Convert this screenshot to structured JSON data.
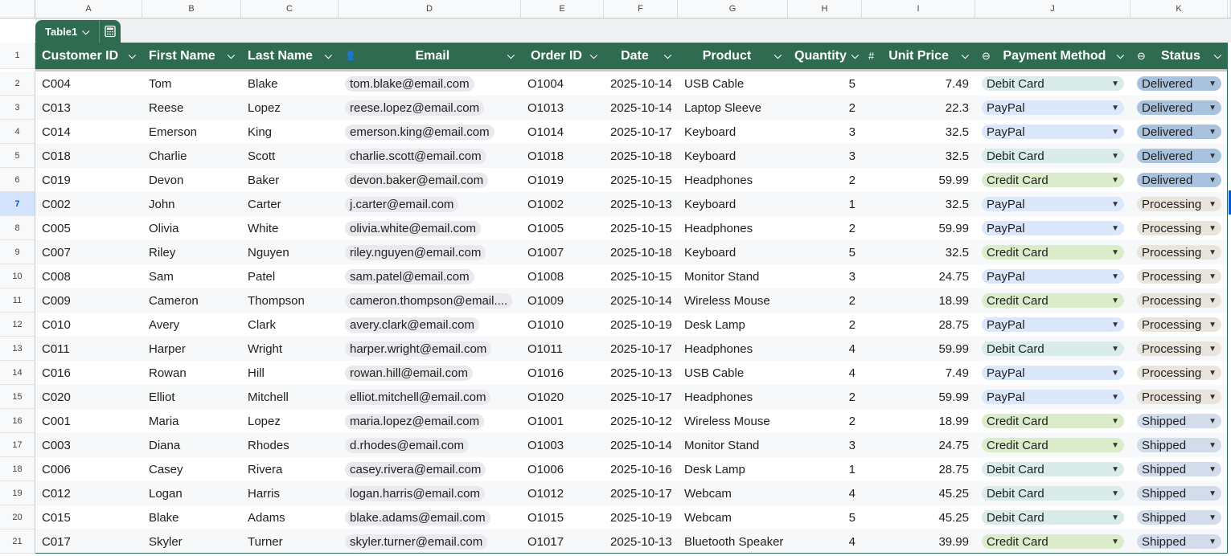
{
  "table": {
    "name": "Table1"
  },
  "colors": {
    "header_bg": "#2f6b50",
    "debit_card": "#d9ecea",
    "paypal": "#dbe8fb",
    "credit_card": "#dbeccb",
    "delivered": "#a9c2de",
    "processing": "#e9e5dd",
    "shipped": "#d3dceb"
  },
  "icons": {
    "email_col": "person-icon",
    "unit_price_col": "hash-icon",
    "dropdown_col": "dropdown-chip-icon",
    "tab_calc": "calculator-icon"
  },
  "column_letters": [
    "A",
    "B",
    "C",
    "D",
    "E",
    "F",
    "G",
    "H",
    "I",
    "J",
    "K"
  ],
  "headers": [
    "Customer ID",
    "First Name",
    "Last Name",
    "Email",
    "Order ID",
    "Date",
    "Product",
    "Quantity",
    "Unit Price",
    "Payment Method",
    "Status"
  ],
  "rows": [
    {
      "n": "2",
      "id": "C004",
      "first": "Tom",
      "last": "Blake",
      "email": "tom.blake@email.com",
      "order": "O1004",
      "date": "2025-10-14",
      "product": "USB Cable",
      "qty": "5",
      "price": "7.49",
      "payment": "Debit Card",
      "status": "Delivered"
    },
    {
      "n": "3",
      "id": "C013",
      "first": "Reese",
      "last": "Lopez",
      "email": "reese.lopez@email.com",
      "order": "O1013",
      "date": "2025-10-14",
      "product": "Laptop Sleeve",
      "qty": "2",
      "price": "22.3",
      "payment": "PayPal",
      "status": "Delivered"
    },
    {
      "n": "4",
      "id": "C014",
      "first": "Emerson",
      "last": "King",
      "email": "emerson.king@email.com",
      "order": "O1014",
      "date": "2025-10-17",
      "product": "Keyboard",
      "qty": "3",
      "price": "32.5",
      "payment": "PayPal",
      "status": "Delivered"
    },
    {
      "n": "5",
      "id": "C018",
      "first": "Charlie",
      "last": "Scott",
      "email": "charlie.scott@email.com",
      "order": "O1018",
      "date": "2025-10-18",
      "product": "Keyboard",
      "qty": "3",
      "price": "32.5",
      "payment": "Debit Card",
      "status": "Delivered"
    },
    {
      "n": "6",
      "id": "C019",
      "first": "Devon",
      "last": "Baker",
      "email": "devon.baker@email.com",
      "order": "O1019",
      "date": "2025-10-15",
      "product": "Headphones",
      "qty": "2",
      "price": "59.99",
      "payment": "Credit Card",
      "status": "Delivered"
    },
    {
      "n": "7",
      "id": "C002",
      "first": "John",
      "last": "Carter",
      "email": "j.carter@email.com",
      "order": "O1002",
      "date": "2025-10-13",
      "product": "Keyboard",
      "qty": "1",
      "price": "32.5",
      "payment": "PayPal",
      "status": "Processing"
    },
    {
      "n": "8",
      "id": "C005",
      "first": "Olivia",
      "last": "White",
      "email": "olivia.white@email.com",
      "order": "O1005",
      "date": "2025-10-15",
      "product": "Headphones",
      "qty": "2",
      "price": "59.99",
      "payment": "PayPal",
      "status": "Processing"
    },
    {
      "n": "9",
      "id": "C007",
      "first": "Riley",
      "last": "Nguyen",
      "email": "riley.nguyen@email.com",
      "order": "O1007",
      "date": "2025-10-18",
      "product": "Keyboard",
      "qty": "5",
      "price": "32.5",
      "payment": "Credit Card",
      "status": "Processing"
    },
    {
      "n": "10",
      "id": "C008",
      "first": "Sam",
      "last": "Patel",
      "email": "sam.patel@email.com",
      "order": "O1008",
      "date": "2025-10-15",
      "product": "Monitor Stand",
      "qty": "3",
      "price": "24.75",
      "payment": "PayPal",
      "status": "Processing"
    },
    {
      "n": "11",
      "id": "C009",
      "first": "Cameron",
      "last": "Thompson",
      "email": "cameron.thompson@email....",
      "order": "O1009",
      "date": "2025-10-14",
      "product": "Wireless Mouse",
      "qty": "2",
      "price": "18.99",
      "payment": "Credit Card",
      "status": "Processing"
    },
    {
      "n": "12",
      "id": "C010",
      "first": "Avery",
      "last": "Clark",
      "email": "avery.clark@email.com",
      "order": "O1010",
      "date": "2025-10-19",
      "product": "Desk Lamp",
      "qty": "2",
      "price": "28.75",
      "payment": "PayPal",
      "status": "Processing"
    },
    {
      "n": "13",
      "id": "C011",
      "first": "Harper",
      "last": "Wright",
      "email": "harper.wright@email.com",
      "order": "O1011",
      "date": "2025-10-17",
      "product": "Headphones",
      "qty": "4",
      "price": "59.99",
      "payment": "Debit Card",
      "status": "Processing"
    },
    {
      "n": "14",
      "id": "C016",
      "first": "Rowan",
      "last": "Hill",
      "email": "rowan.hill@email.com",
      "order": "O1016",
      "date": "2025-10-13",
      "product": "USB Cable",
      "qty": "4",
      "price": "7.49",
      "payment": "PayPal",
      "status": "Processing"
    },
    {
      "n": "15",
      "id": "C020",
      "first": "Elliot",
      "last": "Mitchell",
      "email": "elliot.mitchell@email.com",
      "order": "O1020",
      "date": "2025-10-17",
      "product": "Headphones",
      "qty": "2",
      "price": "59.99",
      "payment": "PayPal",
      "status": "Processing"
    },
    {
      "n": "16",
      "id": "C001",
      "first": "Maria",
      "last": "Lopez",
      "email": "maria.lopez@email.com",
      "order": "O1001",
      "date": "2025-10-12",
      "product": "Wireless Mouse",
      "qty": "2",
      "price": "18.99",
      "payment": "Credit Card",
      "status": "Shipped"
    },
    {
      "n": "17",
      "id": "C003",
      "first": "Diana",
      "last": "Rhodes",
      "email": "d.rhodes@email.com",
      "order": "O1003",
      "date": "2025-10-14",
      "product": "Monitor Stand",
      "qty": "3",
      "price": "24.75",
      "payment": "Credit Card",
      "status": "Shipped"
    },
    {
      "n": "18",
      "id": "C006",
      "first": "Casey",
      "last": "Rivera",
      "email": "casey.rivera@email.com",
      "order": "O1006",
      "date": "2025-10-16",
      "product": "Desk Lamp",
      "qty": "1",
      "price": "28.75",
      "payment": "Debit Card",
      "status": "Shipped"
    },
    {
      "n": "19",
      "id": "C012",
      "first": "Logan",
      "last": "Harris",
      "email": "logan.harris@email.com",
      "order": "O1012",
      "date": "2025-10-17",
      "product": "Webcam",
      "qty": "4",
      "price": "45.25",
      "payment": "Debit Card",
      "status": "Shipped"
    },
    {
      "n": "20",
      "id": "C015",
      "first": "Blake",
      "last": "Adams",
      "email": "blake.adams@email.com",
      "order": "O1015",
      "date": "2025-10-19",
      "product": "Webcam",
      "qty": "5",
      "price": "45.25",
      "payment": "Debit Card",
      "status": "Shipped"
    },
    {
      "n": "21",
      "id": "C017",
      "first": "Skyler",
      "last": "Turner",
      "email": "skyler.turner@email.com",
      "order": "O1017",
      "date": "2025-10-13",
      "product": "Bluetooth Speaker",
      "qty": "4",
      "price": "39.99",
      "payment": "Credit Card",
      "status": "Shipped"
    }
  ]
}
